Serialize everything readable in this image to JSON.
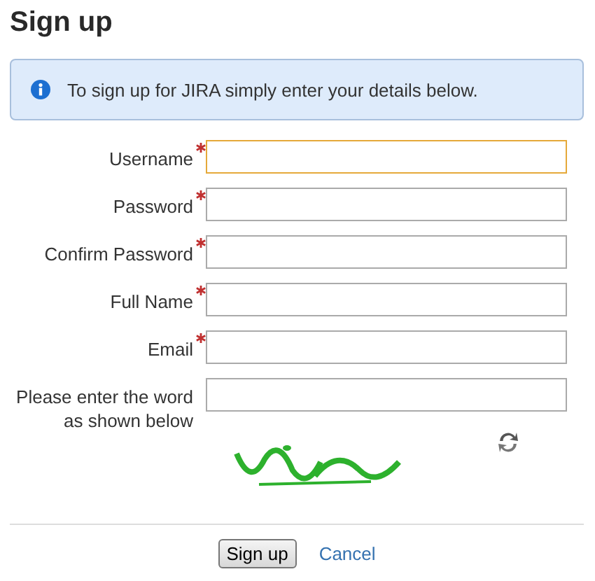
{
  "title": "Sign up",
  "info": {
    "text": "To sign up for JIRA simply enter your details below."
  },
  "fields": [
    {
      "label": "Username",
      "required": true,
      "focused": true
    },
    {
      "label": "Password",
      "required": true,
      "focused": false
    },
    {
      "label": "Confirm Password",
      "required": true,
      "focused": false
    },
    {
      "label": "Full Name",
      "required": true,
      "focused": false
    },
    {
      "label": "Email",
      "required": true,
      "focused": false
    },
    {
      "label": "Please enter the word as shown below",
      "required": false,
      "focused": false
    }
  ],
  "buttons": [
    {
      "label": "Sign up",
      "kind": "button"
    },
    {
      "label": "Cancel",
      "kind": "link"
    }
  ]
}
